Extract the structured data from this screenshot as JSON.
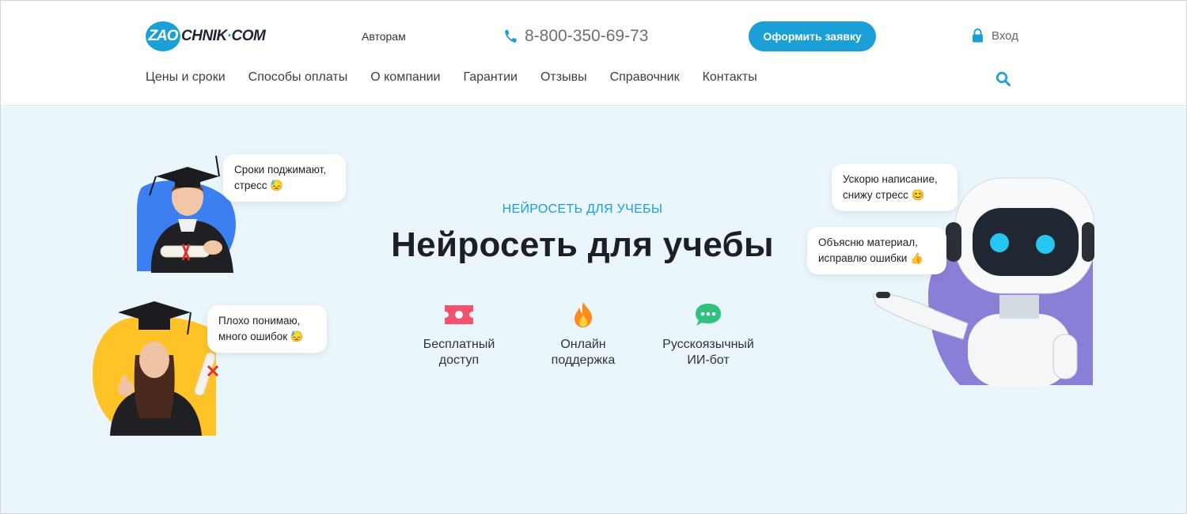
{
  "header": {
    "logo_badge": "ZAO",
    "logo_rest": "CHNIK",
    "logo_dot": "·",
    "logo_tld": "COM",
    "authors_link": "Авторам",
    "phone": "8-800-350-69-73",
    "cta_label": "Оформить заявку",
    "login_label": "Вход"
  },
  "nav": {
    "items": [
      {
        "label": "Цены и сроки"
      },
      {
        "label": "Способы оплаты"
      },
      {
        "label": "О компании"
      },
      {
        "label": "Гарантии"
      },
      {
        "label": "Отзывы"
      },
      {
        "label": "Справочник"
      },
      {
        "label": "Контакты"
      }
    ]
  },
  "hero": {
    "eyebrow": "НЕЙРОСЕТЬ ДЛЯ УЧЕБЫ",
    "title": "Нейросеть для учебы",
    "features": [
      {
        "label": "Бесплатный\nдоступ",
        "icon": "ticket-icon"
      },
      {
        "label": "Онлайн\nподдержка",
        "icon": "flame-icon"
      },
      {
        "label": "Русскоязычный\nИИ-бот",
        "icon": "chat-icon"
      }
    ],
    "bubbles": {
      "student_male": "Сроки поджимают,\nстресс 😓",
      "student_female": "Плохо понимаю,\nмного ошибок 😓",
      "robot_top": "Ускорю написание,\nснижу стресс 😊",
      "robot_bottom": "Объясню материал,\nисправлю ошибки 👍"
    }
  },
  "colors": {
    "accent": "#1aa0d6",
    "hero_bg": "#eaf6fb",
    "blob_blue": "#3b7ff0",
    "blob_yellow": "#ffc328",
    "blob_purple": "#8a7fd6"
  }
}
